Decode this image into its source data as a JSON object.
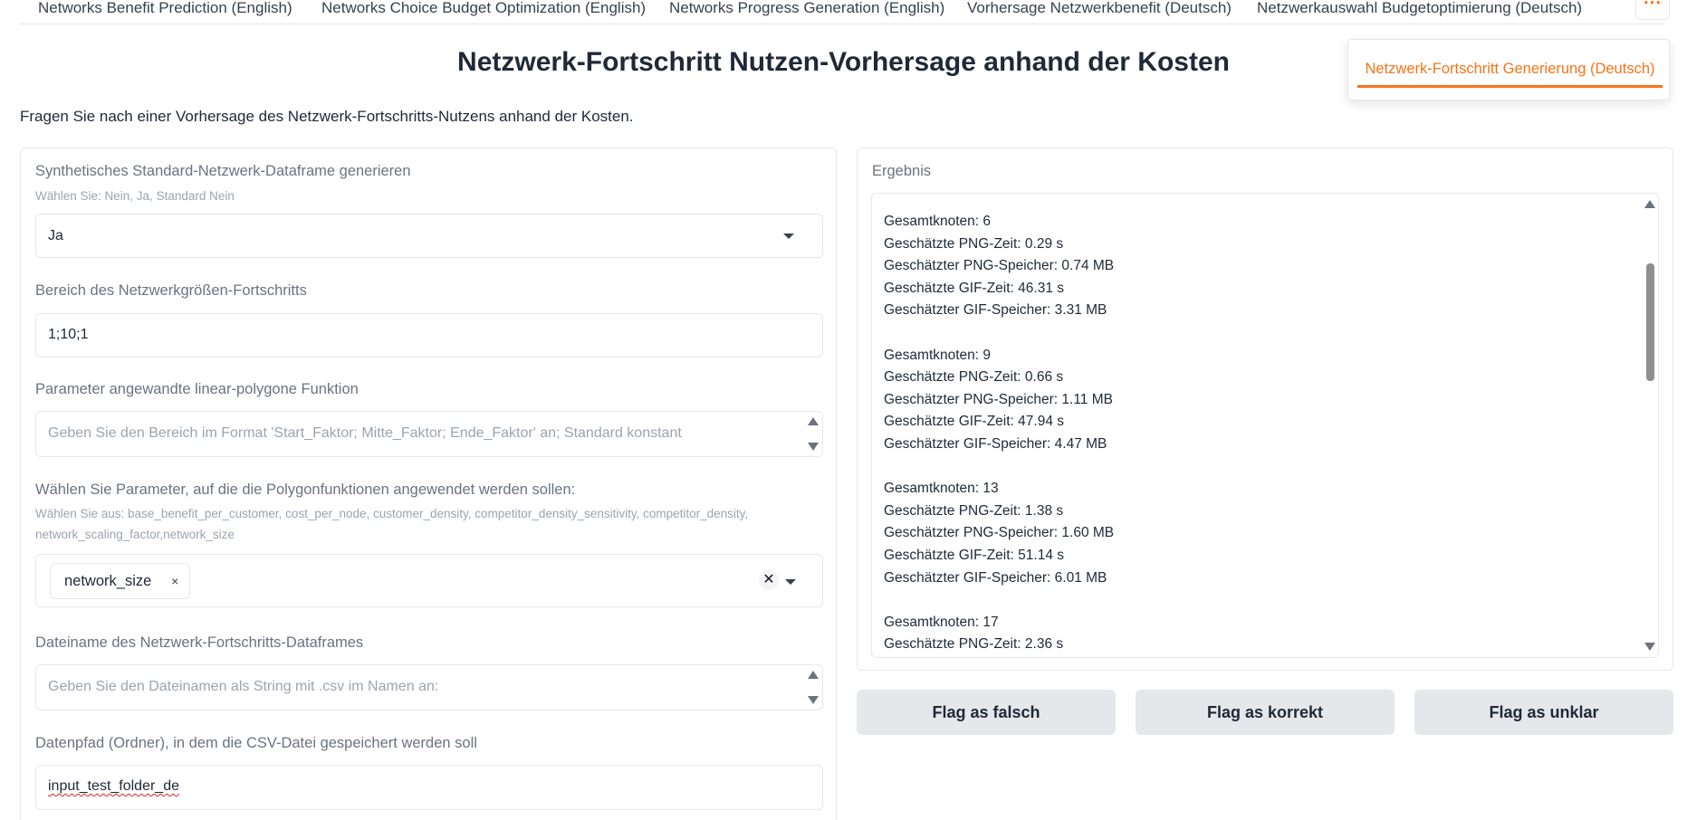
{
  "tabs": [
    "Networks Benefit Prediction (English)",
    "Networks Choice Budget Optimization (English)",
    "Networks Progress Generation (English)",
    "Vorhersage Netzwerkbenefit (Deutsch)",
    "Netzwerkauswahl Budgetoptimierung (Deutsch)"
  ],
  "overflow_menu": {
    "button_label": "⋯",
    "active_tab": "Netzwerk-Fortschritt Generierung (Deutsch)"
  },
  "page": {
    "title": "Netzwerk-Fortschritt Nutzen-Vorhersage anhand der Kosten",
    "description": "Fragen Sie nach einer Vorhersage des Netzwerk-Fortschritts-Nutzens anhand der Kosten."
  },
  "form": {
    "synthetic": {
      "label": "Synthetisches Standard-Netzwerk-Dataframe generieren",
      "info": "Wählen Sie: Nein, Ja, Standard Nein",
      "value": "Ja"
    },
    "range": {
      "label": "Bereich des Netzwerkgrößen-Fortschritts",
      "value": "1;10;1"
    },
    "polygon": {
      "label": "Parameter angewandte linear-polygone Funktion",
      "placeholder": "Geben Sie den Bereich im Format 'Start_Faktor; Mitte_Faktor; Ende_Faktor' an; Standard konstant"
    },
    "params": {
      "label": "Wählen Sie Parameter, auf die die Polygonfunktionen angewendet werden sollen:",
      "info": "Wählen Sie aus: base_benefit_per_customer, cost_per_node, customer_density, competitor_density_sensitivity, competitor_density, network_scaling_factor,network_size",
      "chip": "network_size",
      "chip_remove": "×",
      "clear": "✕"
    },
    "filename": {
      "label": "Dateiname des Netzwerk-Fortschritts-Dataframes",
      "placeholder": "Geben Sie den Dateinamen als String mit .csv im Namen an:"
    },
    "folder": {
      "label": "Datenpfad (Ordner), in dem die CSV-Datei gespeichert werden soll",
      "value": "input_test_folder_de"
    }
  },
  "result": {
    "label": "Ergebnis",
    "lines": [
      "Gesamtknoten: 6",
      "Geschätzte PNG-Zeit: 0.29 s",
      "Geschätzter PNG-Speicher: 0.74 MB",
      "Geschätzte GIF-Zeit: 46.31 s",
      "Geschätzter GIF-Speicher: 3.31 MB",
      "",
      "Gesamtknoten: 9",
      "Geschätzte PNG-Zeit: 0.66 s",
      "Geschätzter PNG-Speicher: 1.11 MB",
      "Geschätzte GIF-Zeit: 47.94 s",
      "Geschätzter GIF-Speicher: 4.47 MB",
      "",
      "Gesamtknoten: 13",
      "Geschätzte PNG-Zeit: 1.38 s",
      "Geschätzter PNG-Speicher: 1.60 MB",
      "Geschätzte GIF-Zeit: 51.14 s",
      "Geschätzter GIF-Speicher: 6.01 MB",
      "",
      "Gesamtknoten: 17",
      "Geschätzte PNG-Zeit: 2.36 s"
    ]
  },
  "flags": {
    "falsch": "Flag as falsch",
    "korrekt": "Flag as korrekt",
    "unklar": "Flag as unklar"
  },
  "colors": {
    "accent": "#f97316",
    "border": "#e5e7eb",
    "button_bg": "#e5e7eb",
    "label": "#6b7280",
    "info": "#9ca3af"
  },
  "icons": {
    "dropdown": "chevron-down-icon",
    "clear": "close-icon",
    "more": "more-horizontal-icon"
  }
}
